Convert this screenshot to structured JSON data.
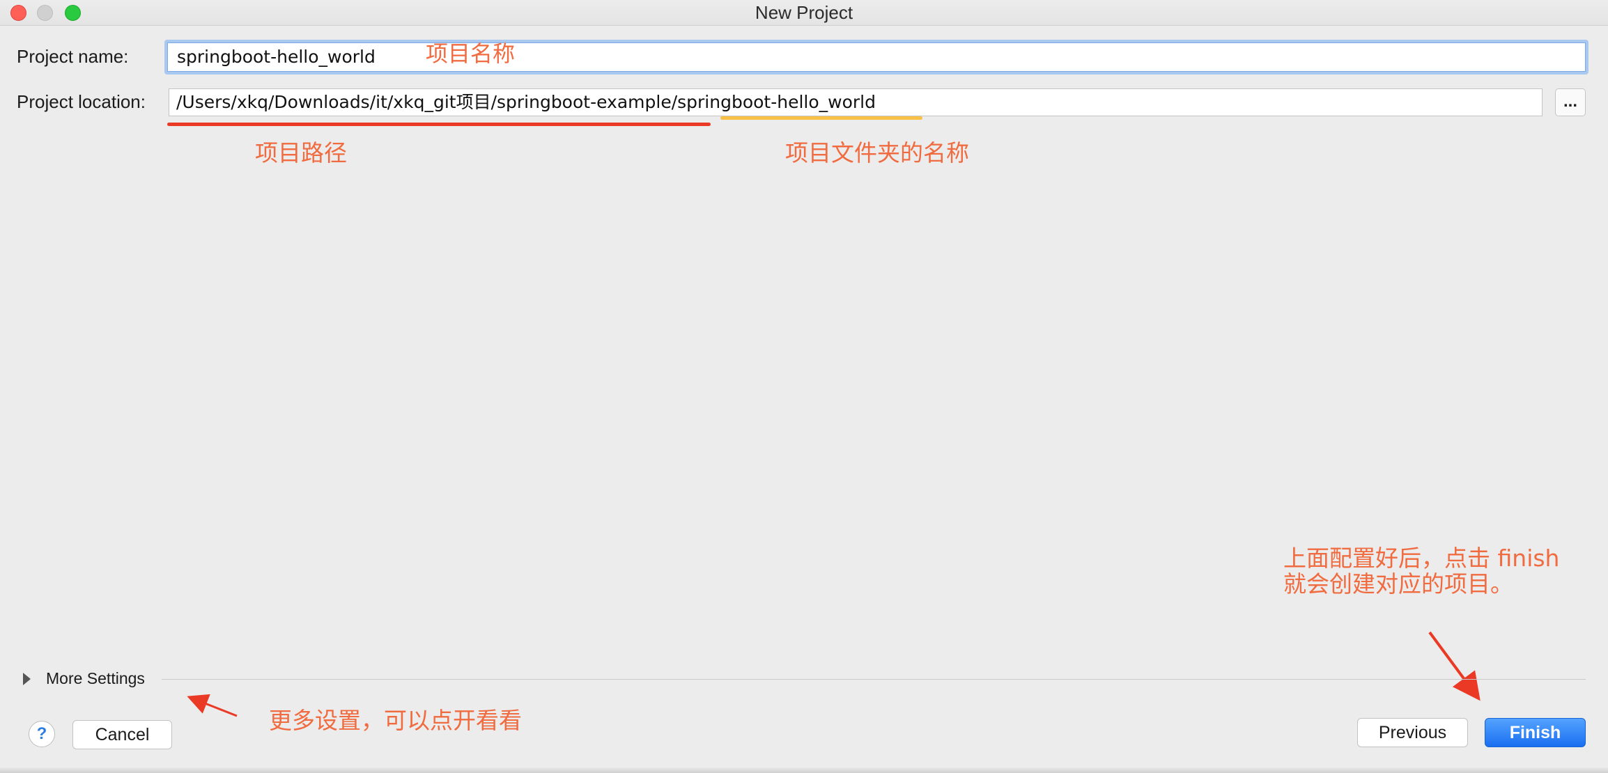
{
  "window": {
    "title": "New Project"
  },
  "form": {
    "project_name_label": "Project name:",
    "project_name_value": "springboot-hello_world",
    "project_location_label": "Project location:",
    "project_location_value": "/Users/xkq/Downloads/it/xkq_git项目/springboot-example/springboot-hello_world",
    "browse_label": "..."
  },
  "more_settings": {
    "label": "More Settings"
  },
  "buttons": {
    "help": "?",
    "cancel": "Cancel",
    "previous": "Previous",
    "finish": "Finish"
  },
  "annotations": {
    "project_name": "项目名称",
    "project_path": "项目路径",
    "folder_name": "项目文件夹的名称",
    "finish_line1": "上面配置好后，点击 finish",
    "finish_line2": "就会创建对应的项目。",
    "more_settings": "更多设置，可以点开看看"
  },
  "colors": {
    "annotation_text": "#f06b3f",
    "path_underline": "#ea3a25",
    "folder_underline": "#f9c046",
    "finish_button": "#1a6ff0"
  }
}
